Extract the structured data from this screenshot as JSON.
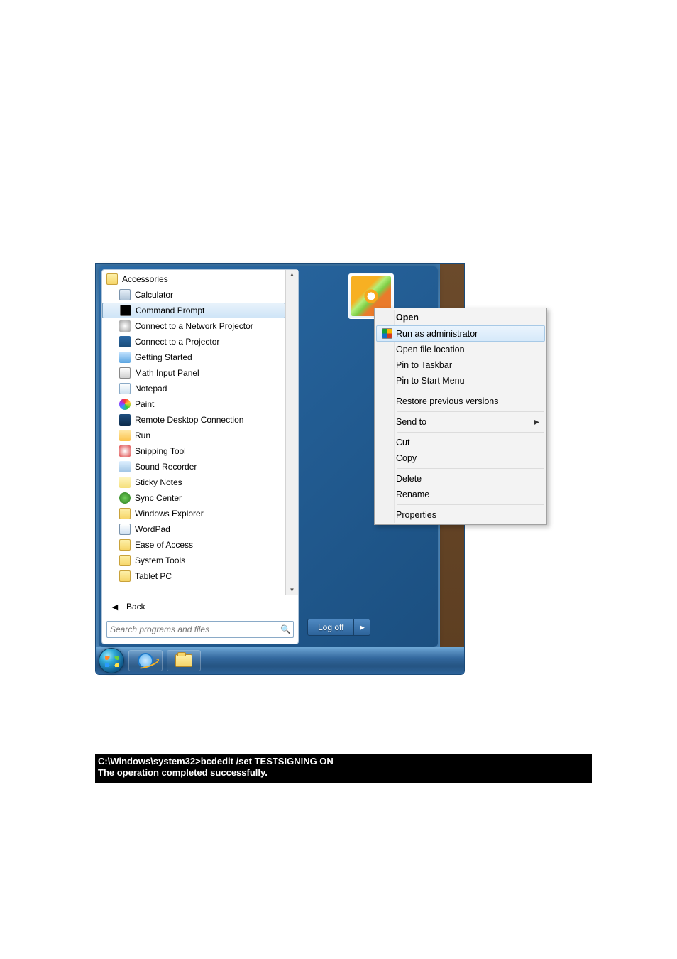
{
  "start_menu": {
    "folder_label": "Accessories",
    "programs": [
      {
        "label": "Calculator",
        "icon": "calc"
      },
      {
        "label": "Command Prompt",
        "icon": "cmd",
        "selected": true
      },
      {
        "label": "Connect to a Network Projector",
        "icon": "proj"
      },
      {
        "label": "Connect to a Projector",
        "icon": "proj2"
      },
      {
        "label": "Getting Started",
        "icon": "gs"
      },
      {
        "label": "Math Input Panel",
        "icon": "math"
      },
      {
        "label": "Notepad",
        "icon": "note"
      },
      {
        "label": "Paint",
        "icon": "paint"
      },
      {
        "label": "Remote Desktop Connection",
        "icon": "rdc"
      },
      {
        "label": "Run",
        "icon": "run"
      },
      {
        "label": "Snipping Tool",
        "icon": "snip"
      },
      {
        "label": "Sound Recorder",
        "icon": "rec"
      },
      {
        "label": "Sticky Notes",
        "icon": "sticky"
      },
      {
        "label": "Sync Center",
        "icon": "sync"
      },
      {
        "label": "Windows Explorer",
        "icon": "winexp"
      },
      {
        "label": "WordPad",
        "icon": "wordpad"
      },
      {
        "label": "Ease of Access",
        "icon": "folder"
      },
      {
        "label": "System Tools",
        "icon": "folder"
      },
      {
        "label": "Tablet PC",
        "icon": "folder"
      }
    ],
    "back_label": "Back",
    "search_placeholder": "Search programs and files",
    "logoff_label": "Log off"
  },
  "context_menu": {
    "items": [
      {
        "label": "Open",
        "bold": true
      },
      {
        "label": "Run as administrator",
        "icon": "shield",
        "highlight": true
      },
      {
        "label": "Open file location"
      },
      {
        "label": "Pin to Taskbar"
      },
      {
        "label": "Pin to Start Menu"
      },
      {
        "sep": true
      },
      {
        "label": "Restore previous versions"
      },
      {
        "sep": true
      },
      {
        "label": "Send to",
        "submenu": true
      },
      {
        "sep": true
      },
      {
        "label": "Cut"
      },
      {
        "label": "Copy"
      },
      {
        "sep": true
      },
      {
        "label": "Delete"
      },
      {
        "label": "Rename"
      },
      {
        "sep": true
      },
      {
        "label": "Properties"
      }
    ]
  },
  "console": {
    "line1": "C:\\Windows\\system32>bcdedit /set TESTSIGNING ON",
    "line2": "The operation completed successfully."
  }
}
